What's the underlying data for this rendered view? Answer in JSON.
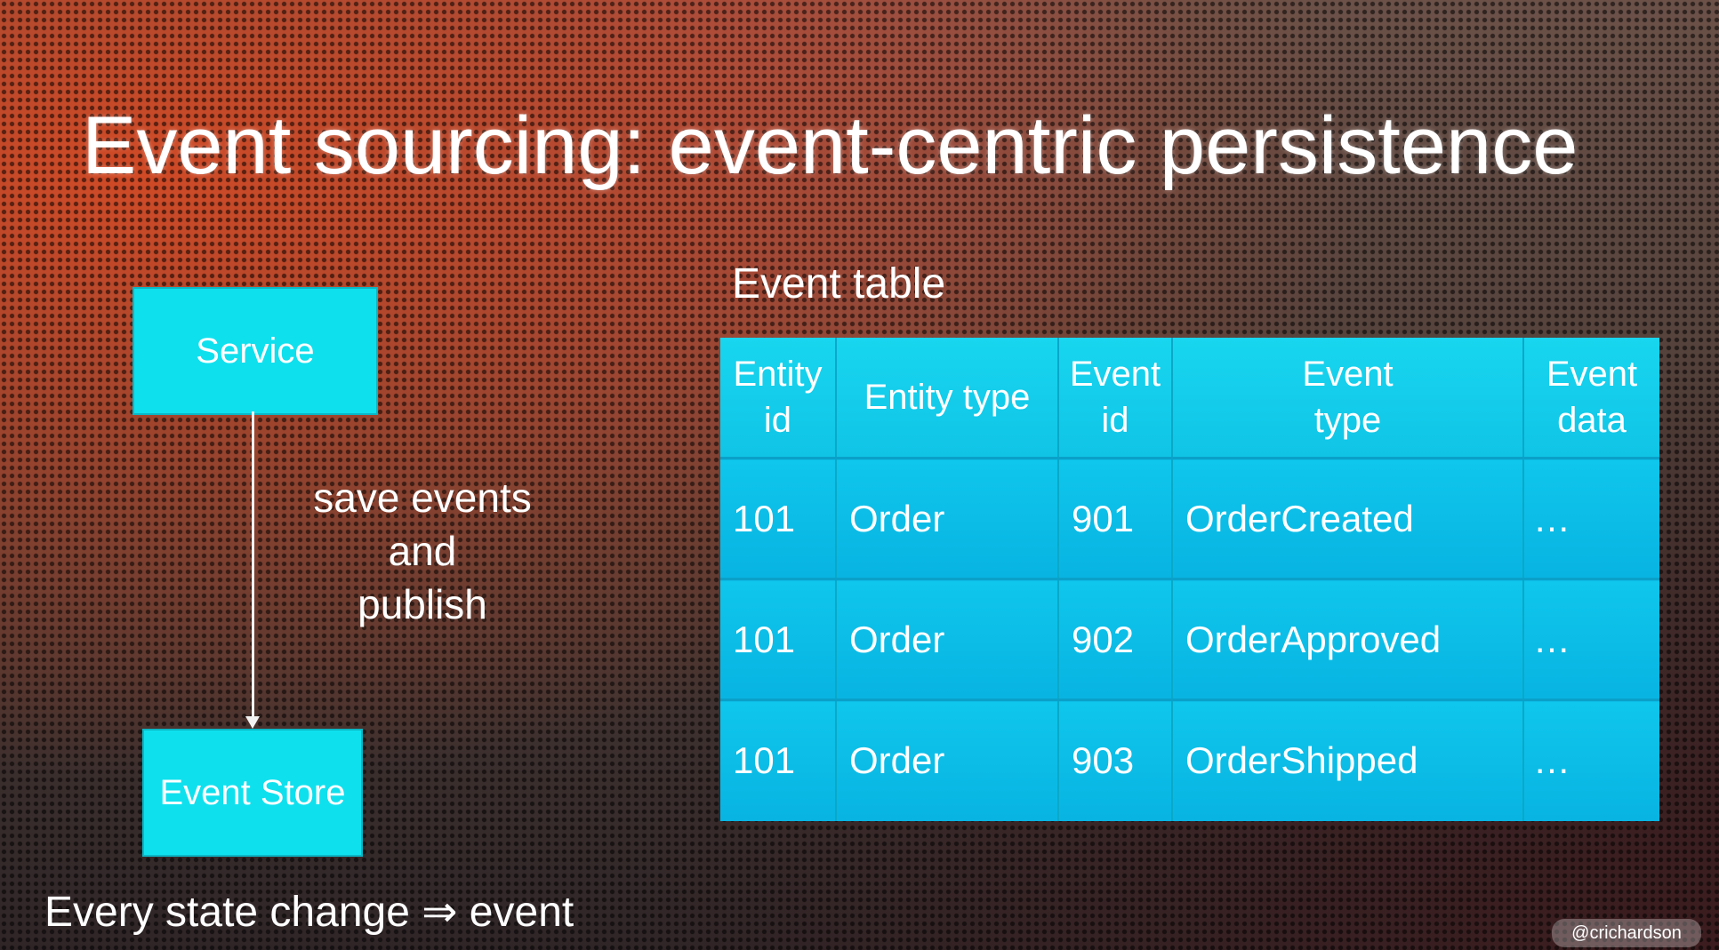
{
  "slide": {
    "title": "Event sourcing: event-centric persistence",
    "footer": "Every state change ⇒ event",
    "handle": "@crichardson"
  },
  "diagram": {
    "nodes": [
      {
        "id": "service",
        "label": "Service"
      },
      {
        "id": "event-store",
        "label": "Event Store"
      }
    ],
    "edges": [
      {
        "from": "service",
        "to": "event-store",
        "label_lines": [
          "save events",
          "and",
          "publish"
        ]
      }
    ]
  },
  "event_table": {
    "caption": "Event table",
    "headers": [
      [
        "Entity",
        "id"
      ],
      [
        "Entity type"
      ],
      [
        "Event",
        "id"
      ],
      [
        "Event",
        "type"
      ],
      [
        "Event",
        "data"
      ]
    ],
    "rows": [
      [
        "101",
        "Order",
        "901",
        "OrderCreated",
        "…"
      ],
      [
        "101",
        "Order",
        "902",
        "OrderApproved",
        "…"
      ],
      [
        "101",
        "Order",
        "903",
        "OrderShipped",
        "…"
      ]
    ]
  },
  "colors": {
    "box_fill": "#0fe0ee",
    "table_fill": "#12c6e8",
    "text": "#ffffff"
  }
}
